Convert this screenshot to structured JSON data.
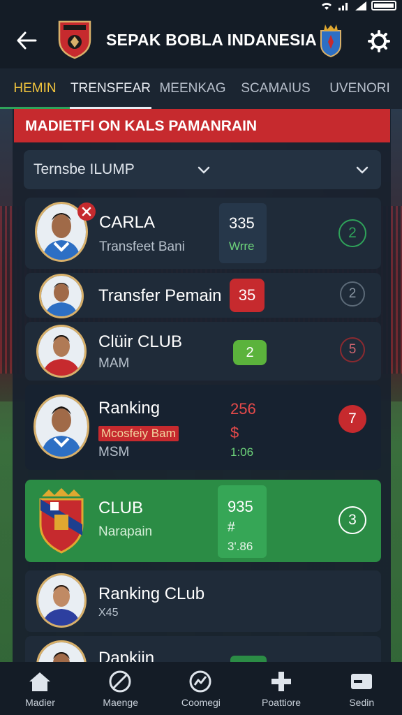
{
  "app": {
    "title": "SEPAK BOBLA INDANESIA"
  },
  "tabs": [
    {
      "label": "HEMIN"
    },
    {
      "label": "TRENSFEAR"
    },
    {
      "label": "MEENKAG"
    },
    {
      "label": "SCAMAIUS"
    },
    {
      "label": "UVENORI"
    }
  ],
  "banner": {
    "title": "MADIETFI ON KALS PAMANRAIN"
  },
  "filter": {
    "label": "Ternsbe ILUMP"
  },
  "rows": [
    {
      "name": "CARLA",
      "subtitle": "Transfeet Bani",
      "stat": "335",
      "stat_sub": "Wrre",
      "rank": "2",
      "rank_color": "#2fa35a"
    },
    {
      "name": "Transfer Pemain",
      "badge": "35",
      "rank": "2",
      "rank_color": "#8a96a3"
    },
    {
      "name": "Clüir CLUB",
      "subtitle": "MAM",
      "badge": "2",
      "rank": "5",
      "rank_color": "#c62a2e"
    },
    {
      "name": "Ranking",
      "tag": "Mcosfeiy Bam",
      "subtitle": "MSM",
      "stat": "256",
      "stat_mid": "$",
      "stat_sub": "1:06",
      "rank": "7",
      "rank_color": "#c62a2e"
    },
    {
      "name": "CLUB",
      "subtitle": "Narapain",
      "stat": "935",
      "stat_mid": "#",
      "stat_sub": "3'.86",
      "rank": "3",
      "rank_color": "#ffffff"
    },
    {
      "name": "Ranking CLub",
      "subtitle": "X45"
    },
    {
      "name": "Dapkiin"
    }
  ],
  "nav": [
    {
      "label": "Madier",
      "icon": "home-icon"
    },
    {
      "label": "Maenge",
      "icon": "ban-icon"
    },
    {
      "label": "Coomegi",
      "icon": "chart-icon"
    },
    {
      "label": "Poattiore",
      "icon": "plus-icon"
    },
    {
      "label": "Sedin",
      "icon": "card-icon"
    }
  ],
  "colors": {
    "accent_red": "#c62a2e",
    "accent_green": "#2b8c45",
    "tab_active": "#f2c53d"
  }
}
